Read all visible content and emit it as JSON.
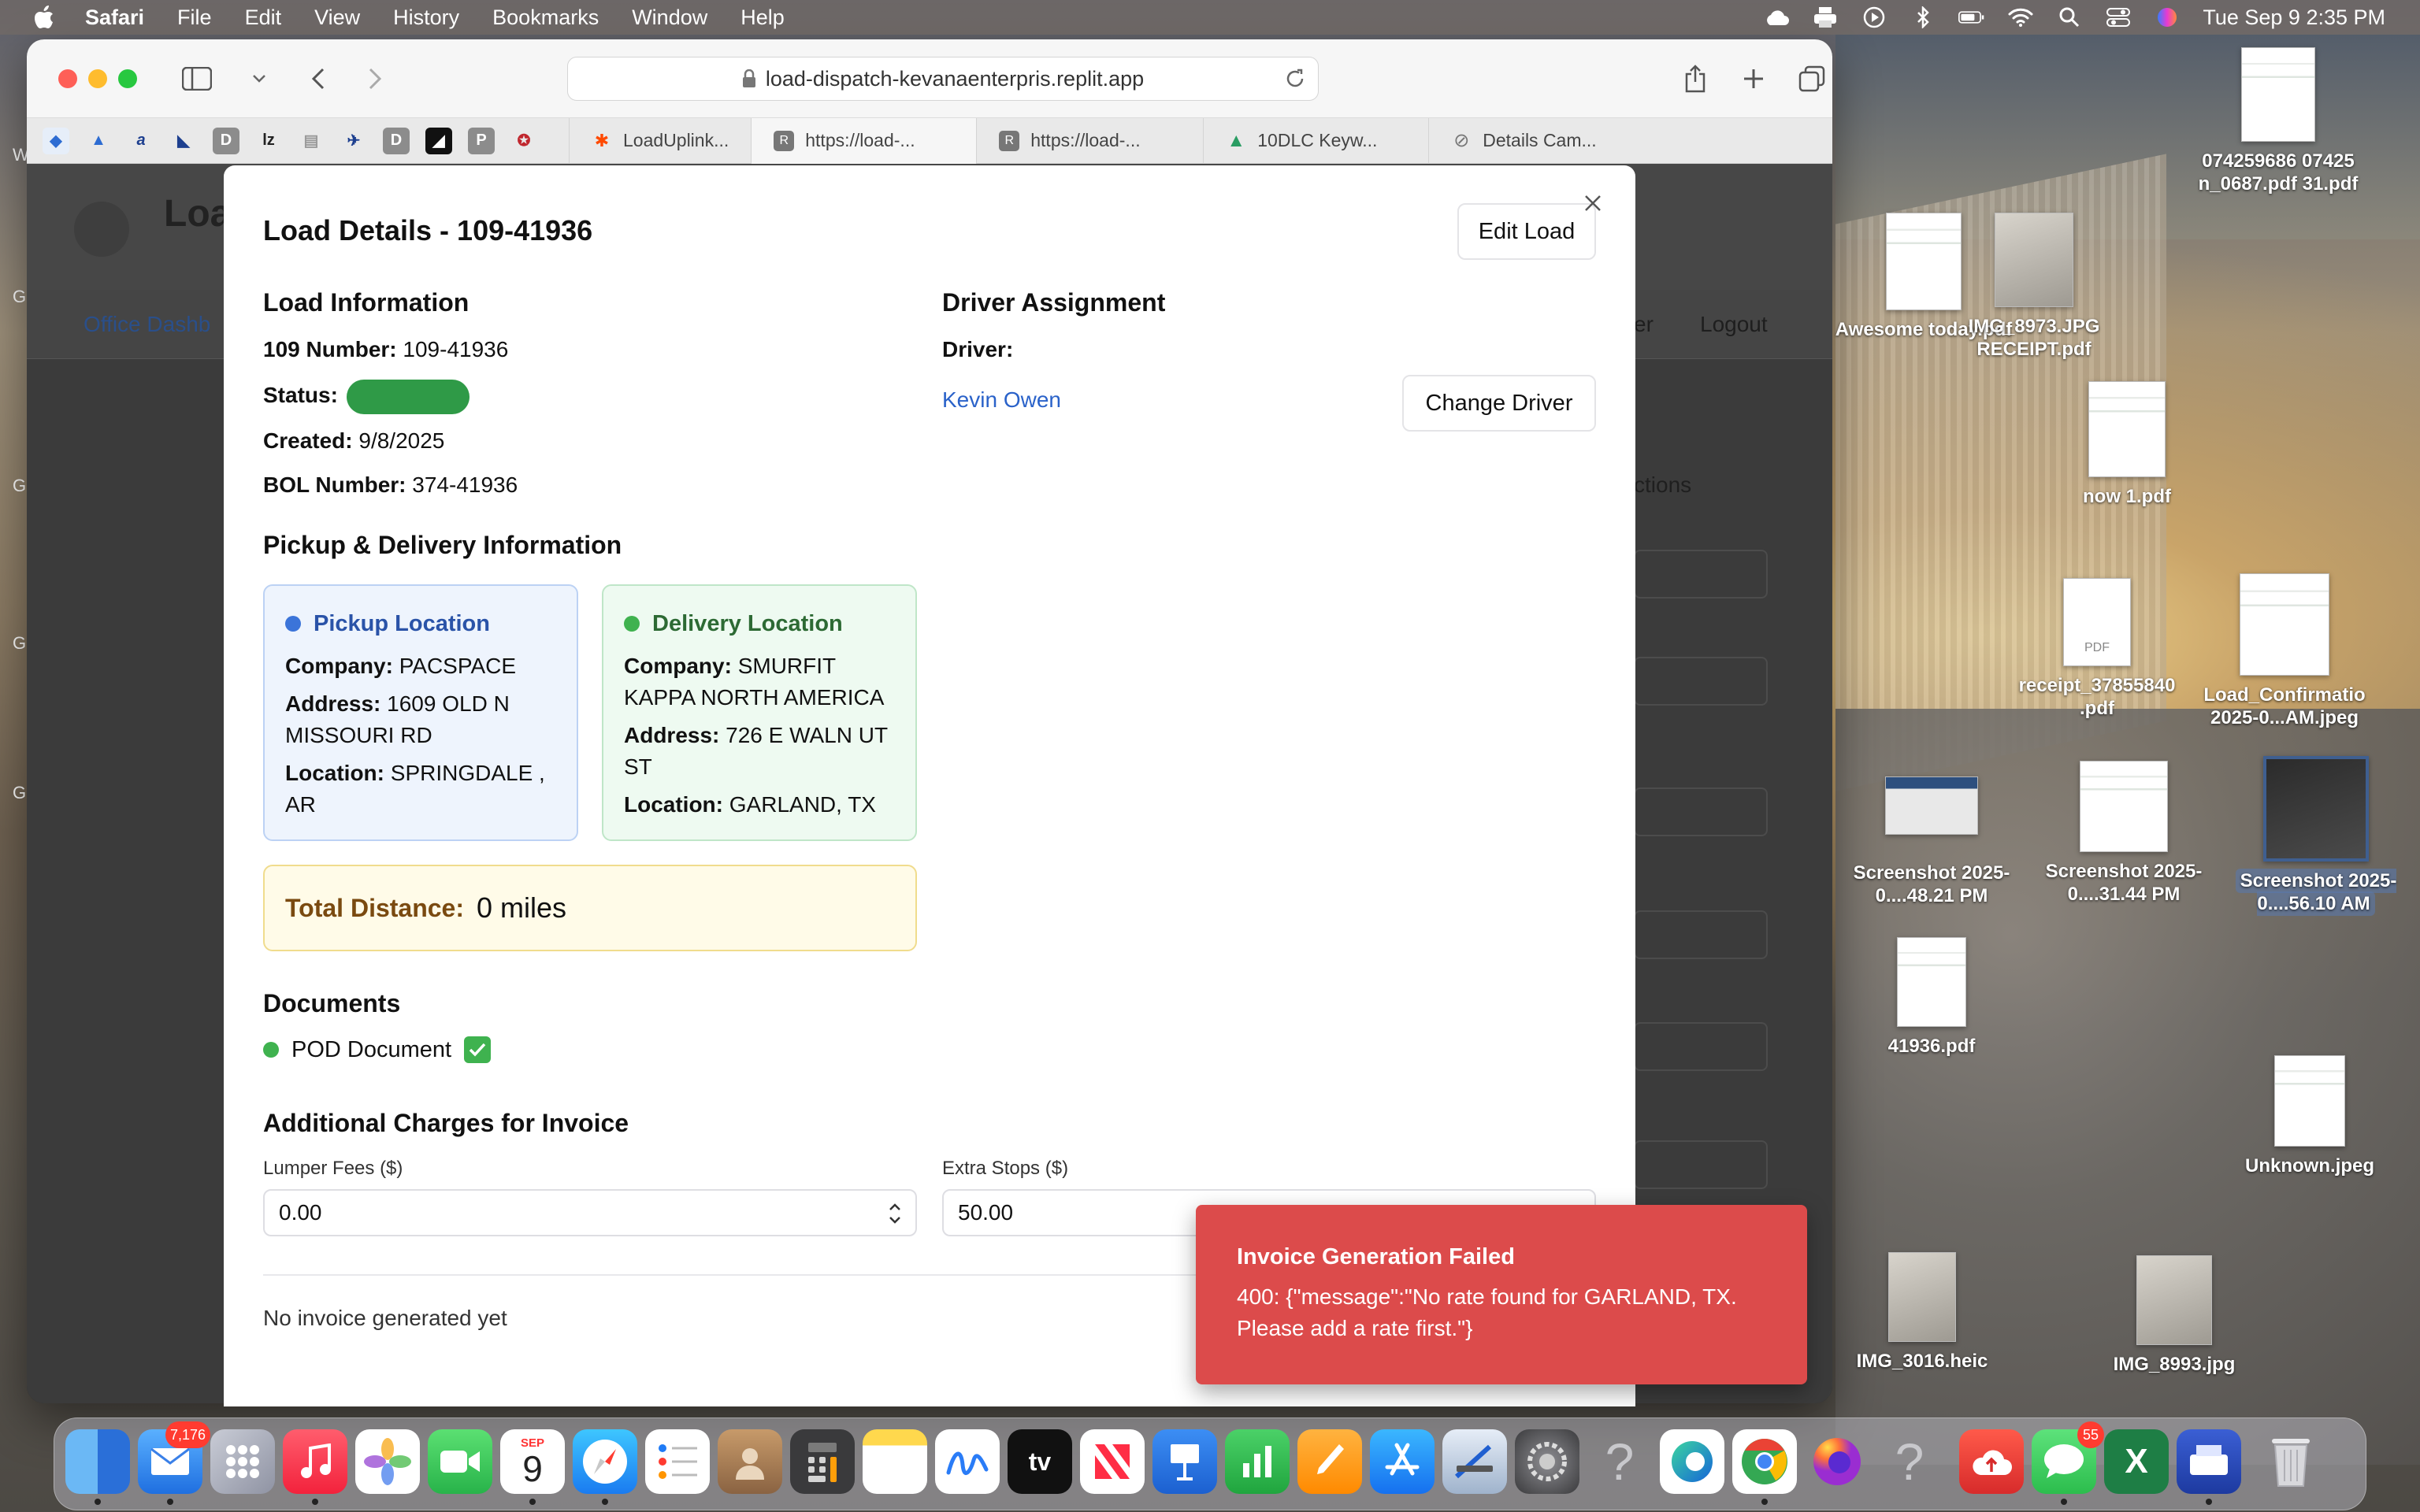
{
  "menubar": {
    "app_name": "Safari",
    "menus": [
      "File",
      "Edit",
      "View",
      "History",
      "Bookmarks",
      "Window",
      "Help"
    ],
    "datetime": "Tue Sep 9  2:35 PM"
  },
  "browser": {
    "url": "load-dispatch-kevanaenterpris.replit.app",
    "tabs": [
      {
        "label": "LoadUplink...",
        "icon": "zapier-icon",
        "color": "#ff4a00"
      },
      {
        "label": "https://load-...",
        "icon": "replit-icon",
        "color": "#777"
      },
      {
        "label": "https://load-...",
        "icon": "replit-icon",
        "color": "#777"
      },
      {
        "label": "10DLC Keyw...",
        "icon": "tree-icon",
        "color": "#2a9d63"
      },
      {
        "label": "Details Cam...",
        "icon": "compass-icon",
        "color": "#777"
      }
    ]
  },
  "page_behind": {
    "nav_active": "Office Dashb",
    "nav_right_1": "er",
    "logout": "Logout",
    "actions": "ctions"
  },
  "modal": {
    "title": "Load Details - 109-41936",
    "edit_button": "Edit Load",
    "load_info": {
      "heading": "Load Information",
      "number_label": "109 Number:",
      "number_value": "109-41936",
      "status_label": "Status:",
      "created_label": "Created:",
      "created_value": "9/8/2025",
      "bol_label": "BOL Number:",
      "bol_value": "374-41936"
    },
    "driver": {
      "heading": "Driver Assignment",
      "label": "Driver:",
      "name": "Kevin Owen",
      "change_button": "Change Driver"
    },
    "pickup_delivery": {
      "heading": "Pickup & Delivery Information",
      "pickup": {
        "title": "Pickup Location",
        "company_label": "Company:",
        "company": "PACSPACE",
        "address_label": "Address:",
        "address": "1609 OLD N MISSOURI RD",
        "location_label": "Location:",
        "location": "SPRINGDALE , AR",
        "color": "#3b74d9"
      },
      "delivery": {
        "title": "Delivery Location",
        "company_label": "Company:",
        "company": "SMURFIT KAPPA NORTH AMERICA",
        "address_label": "Address:",
        "address": "726 E WALN UT ST",
        "location_label": "Location:",
        "location": "GARLAND, TX",
        "color": "#3fb24f"
      }
    },
    "distance": {
      "label": "Total Distance:",
      "value": "0 miles"
    },
    "documents": {
      "heading": "Documents",
      "item": "POD Document"
    },
    "charges": {
      "heading": "Additional Charges for Invoice",
      "lumper_label": "Lumper Fees ($)",
      "lumper_value": "0.00",
      "extra_label": "Extra Stops ($)",
      "extra_value": "50.00"
    },
    "invoice_status": "No invoice generated yet"
  },
  "toast": {
    "title": "Invoice Generation Failed",
    "message": "400: {\"message\":\"No rate found for GARLAND, TX. Please add a rate first.\"}"
  },
  "desktop": {
    "icons": [
      {
        "label": "074259686 07425 n_0687.pdf 31.pdf"
      },
      {
        "label": "Awesome today.pdf"
      },
      {
        "label": "IMG_8973.JPG RECEIPT.pdf"
      },
      {
        "label": "now 1.pdf"
      },
      {
        "label": "receipt_37855840 .pdf"
      },
      {
        "label": "Load_Confirmatio 2025-0...AM.jpeg"
      },
      {
        "label": "Screenshot 2025-0....48.21 PM"
      },
      {
        "label": "Screenshot 2025-0....31.44 PM"
      },
      {
        "label": "Screenshot 2025-0....56.10 AM"
      },
      {
        "label": "41936.pdf"
      },
      {
        "label": "Unknown.jpeg"
      },
      {
        "label": "IMG_3016.heic"
      },
      {
        "label": "IMG_8993.jpg"
      }
    ]
  },
  "dock": {
    "mail_badge": "7,176",
    "calendar_month": "SEP",
    "calendar_day": "9",
    "messages_badge": "55"
  }
}
